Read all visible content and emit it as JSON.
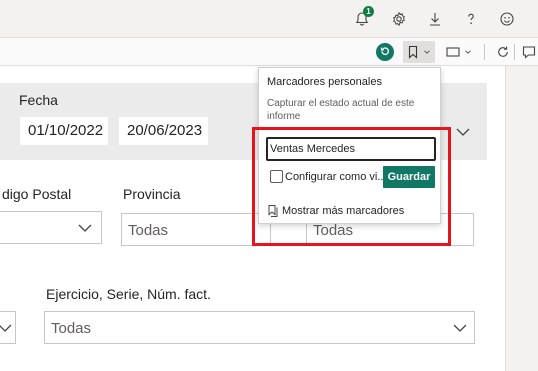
{
  "topbar": {
    "notification_count": "1",
    "icons": [
      "bell-icon",
      "gear-icon",
      "download-icon",
      "help-icon",
      "feedback-smiley-icon"
    ]
  },
  "toolbar": {
    "icons": [
      "reset-icon",
      "bookmark-icon",
      "view-icon",
      "refresh-icon",
      "comment-icon"
    ]
  },
  "filters": {
    "fecha_label": "Fecha",
    "fecha_start": "01/10/2022",
    "fecha_end": "20/06/2023",
    "codigo_postal_label": "digo Postal",
    "provincia_label": "Provincia",
    "provincia_value": "Todas",
    "third_value": "Todas",
    "ejercicio_label": "Ejercicio, Serie, Núm. fact.",
    "ejercicio_value": "Todas"
  },
  "bookmarks_flyout": {
    "title": "Marcadores personales",
    "description": "Capturar el estado actual de este informe",
    "name_value": "Ventas Mercedes",
    "default_checkbox_label": "Configurar como vi...",
    "save_label": "Guardar",
    "more_label": "Mostrar más marcadores"
  },
  "colors": {
    "accent": "#117865",
    "highlight": "#e8141c",
    "badge": "#107c41"
  }
}
